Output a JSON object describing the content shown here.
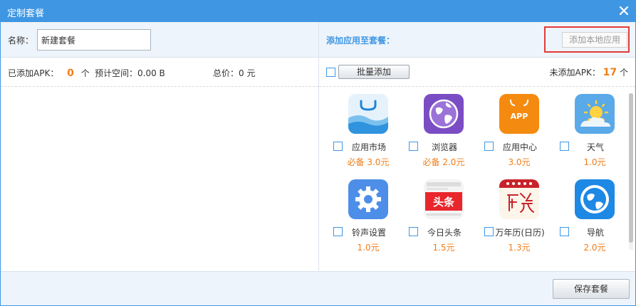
{
  "window": {
    "title": "定制套餐"
  },
  "package": {
    "name_label": "名称：",
    "name_value": "新建套餐",
    "added_label": "已添加APK：",
    "added_count": "0",
    "added_unit": "个",
    "space_label": "预计空间：0.00 B",
    "total_label": "总价：0 元"
  },
  "apps_panel": {
    "title": "添加应用至套餐：",
    "add_local_label": "添加本地应用",
    "batch_add_label": "批量添加",
    "not_added_label": "未添加APK：",
    "not_added_count": "17",
    "not_added_unit": "个"
  },
  "apps": [
    {
      "name": "应用市场",
      "price": "必备 3.0元",
      "icon": "app-market-icon"
    },
    {
      "name": "浏览器",
      "price": "必备 2.0元",
      "icon": "browser-icon"
    },
    {
      "name": "应用中心",
      "price": "3.0元",
      "icon": "app-center-icon",
      "icon_text": "APP"
    },
    {
      "name": "天气",
      "price": "1.0元",
      "icon": "weather-icon"
    },
    {
      "name": "铃声设置",
      "price": "1.0元",
      "icon": "ringtone-settings-icon"
    },
    {
      "name": "今日头条",
      "price": "1.5元",
      "icon": "toutiao-icon",
      "icon_text": "头条"
    },
    {
      "name": "万年历(日历)",
      "price": "1.3元",
      "icon": "calendar-icon"
    },
    {
      "name": "导航",
      "price": "2.0元",
      "icon": "navigation-icon"
    }
  ],
  "footer": {
    "save_label": "保存套餐"
  },
  "colors": {
    "accent": "#3f97e4",
    "price": "#f07d18",
    "highlight": "#e23a3a"
  }
}
